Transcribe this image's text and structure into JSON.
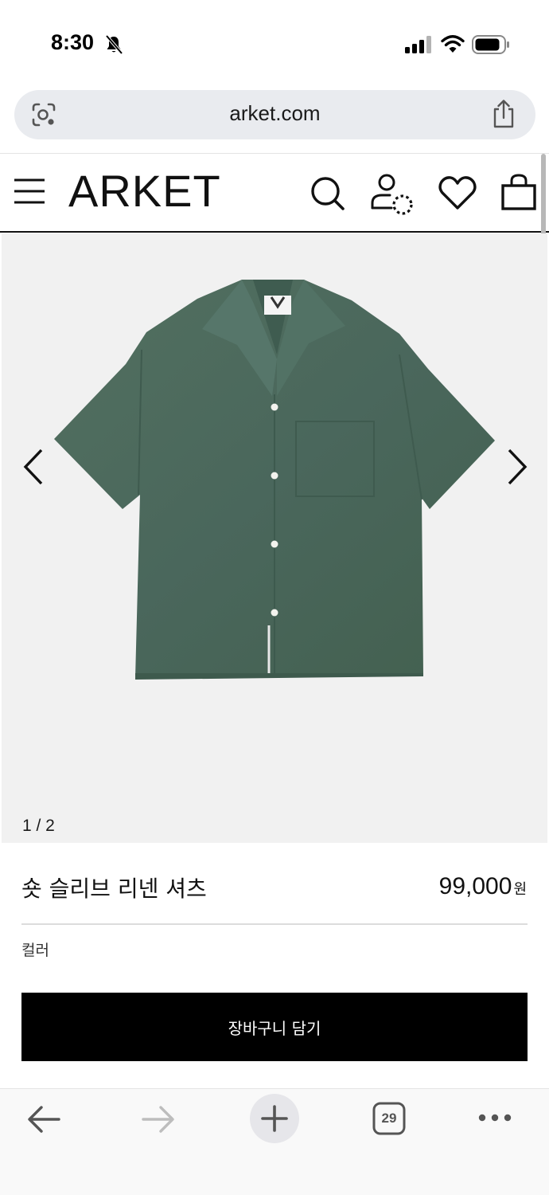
{
  "status_bar": {
    "time": "8:30",
    "icons": [
      "mute-bell-icon",
      "cellular-signal-icon",
      "wifi-icon",
      "battery-icon"
    ]
  },
  "browser": {
    "url": "arket.com",
    "tab_count": "29",
    "icons": [
      "lens-icon",
      "share-icon",
      "back-arrow-icon",
      "forward-arrow-icon",
      "plus-icon",
      "tabs-icon",
      "more-icon"
    ]
  },
  "header": {
    "brand": "ARKET",
    "icons": [
      "menu-icon",
      "search-icon",
      "account-icon",
      "heart-icon",
      "shopping-bag-icon"
    ]
  },
  "gallery": {
    "counter": "1 / 2",
    "image_subject": "short-sleeve green linen shirt",
    "background_color": "#f1f1f1",
    "shirt_color": "#4a675c"
  },
  "product": {
    "name": "숏 슬리브 리넨 셔츠",
    "price": "99,000",
    "currency": "원",
    "color_label": "컬러",
    "add_to_cart_label": "장바구니 담기"
  },
  "colors": {
    "cta_background": "#000000",
    "cta_text": "#ffffff",
    "url_bar": "#e9ebef"
  }
}
